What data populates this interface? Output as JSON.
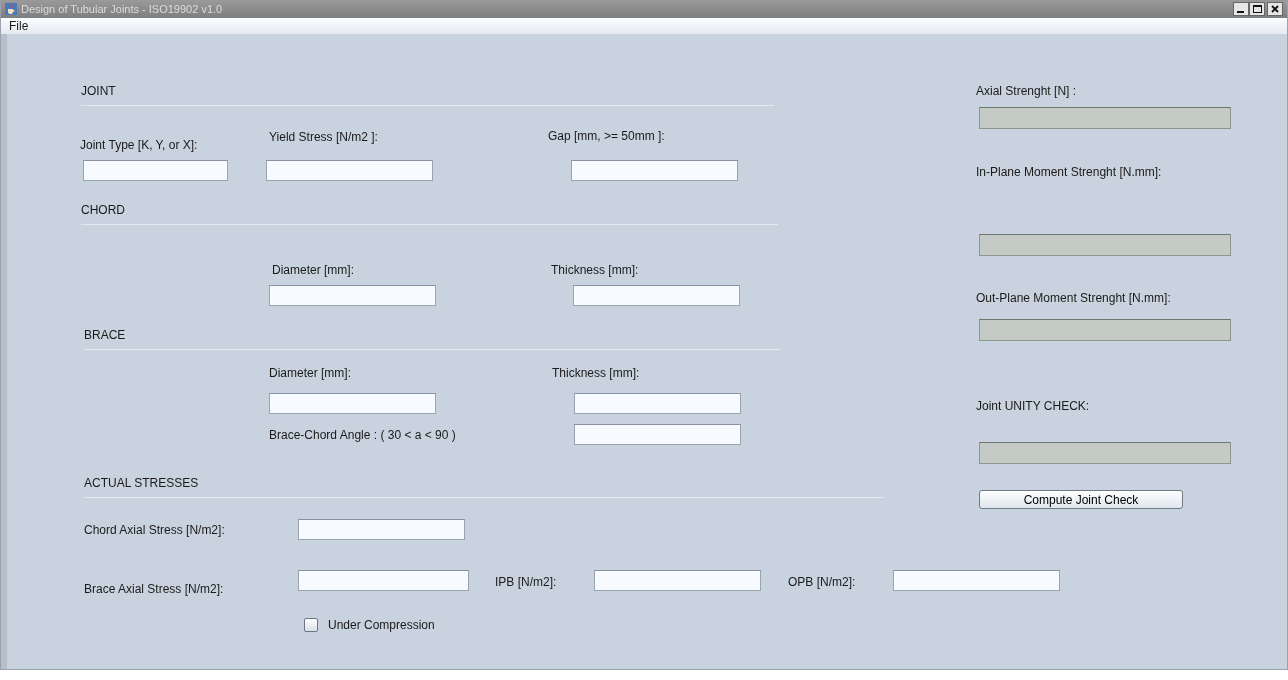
{
  "window": {
    "title": "Design of Tubular Joints - ISO19902 v1.0"
  },
  "menu": [
    "File"
  ],
  "sections": [
    {
      "title": "JOINT",
      "fields": [
        {
          "label": "Joint Type [K, Y, or X]:",
          "disabled": false
        },
        {
          "label": "Yield Stress [N/m2 ]:",
          "disabled": false
        },
        {
          "label": "Gap [mm, >= 50mm ]:",
          "disabled": false
        }
      ]
    },
    {
      "title": "CHORD",
      "fields": [
        {
          "label": "Diameter [mm]:",
          "disabled": false
        },
        {
          "label": "Thickness [mm]:",
          "disabled": false
        }
      ]
    },
    {
      "title": "BRACE",
      "fields": [
        {
          "label": "Diameter [mm]:",
          "disabled": false
        },
        {
          "label": "Thickness [mm]:",
          "disabled": false
        },
        {
          "label": "Brace-Chord Angle :  ( 30 < a <  90 )",
          "disabled": false
        }
      ]
    },
    {
      "title": "ACTUAL STRESSES",
      "fields": [
        {
          "label": "Chord Axial Stress [N/m2]:",
          "disabled": false
        },
        {
          "label": "Brace Axial Stress [N/m2]:",
          "disabled": false
        },
        {
          "label": "IPB [N/m2]:",
          "disabled": false
        },
        {
          "label": "OPB [N/m2]:",
          "disabled": false
        }
      ]
    }
  ],
  "compression": {
    "label": "Under Compression",
    "checked": false
  },
  "results": [
    {
      "label": "Axial Strenght [N] :",
      "disabled": true
    },
    {
      "label": "In-Plane Moment Strenght [N.mm]:",
      "disabled": true
    },
    {
      "label": "Out-Plane Moment Strenght [N.mm]:",
      "disabled": true
    },
    {
      "label": "Joint UNITY CHECK:",
      "disabled": true
    }
  ],
  "button": "Compute Joint Check"
}
